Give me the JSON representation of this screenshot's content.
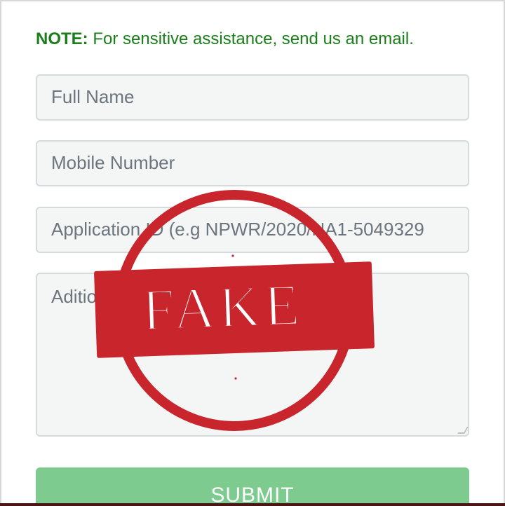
{
  "note": {
    "label": "NOTE:",
    "text": " For sensitive assistance, send us an email."
  },
  "form": {
    "full_name_placeholder": "Full Name",
    "mobile_placeholder": "Mobile Number",
    "application_id_placeholder": "Application ID (e.g NPWR/2020/NA1-5049329",
    "additional_placeholder": "Aditional",
    "submit_label": "SUBMIT"
  },
  "stamp": {
    "text": "FAKE",
    "color": "#c8252d"
  },
  "colors": {
    "note": "#1a7f1a",
    "submit_bg": "#7dcb8f",
    "field_bg": "#f4f6f6",
    "field_border": "#d6dadd",
    "placeholder": "#6c757d"
  }
}
